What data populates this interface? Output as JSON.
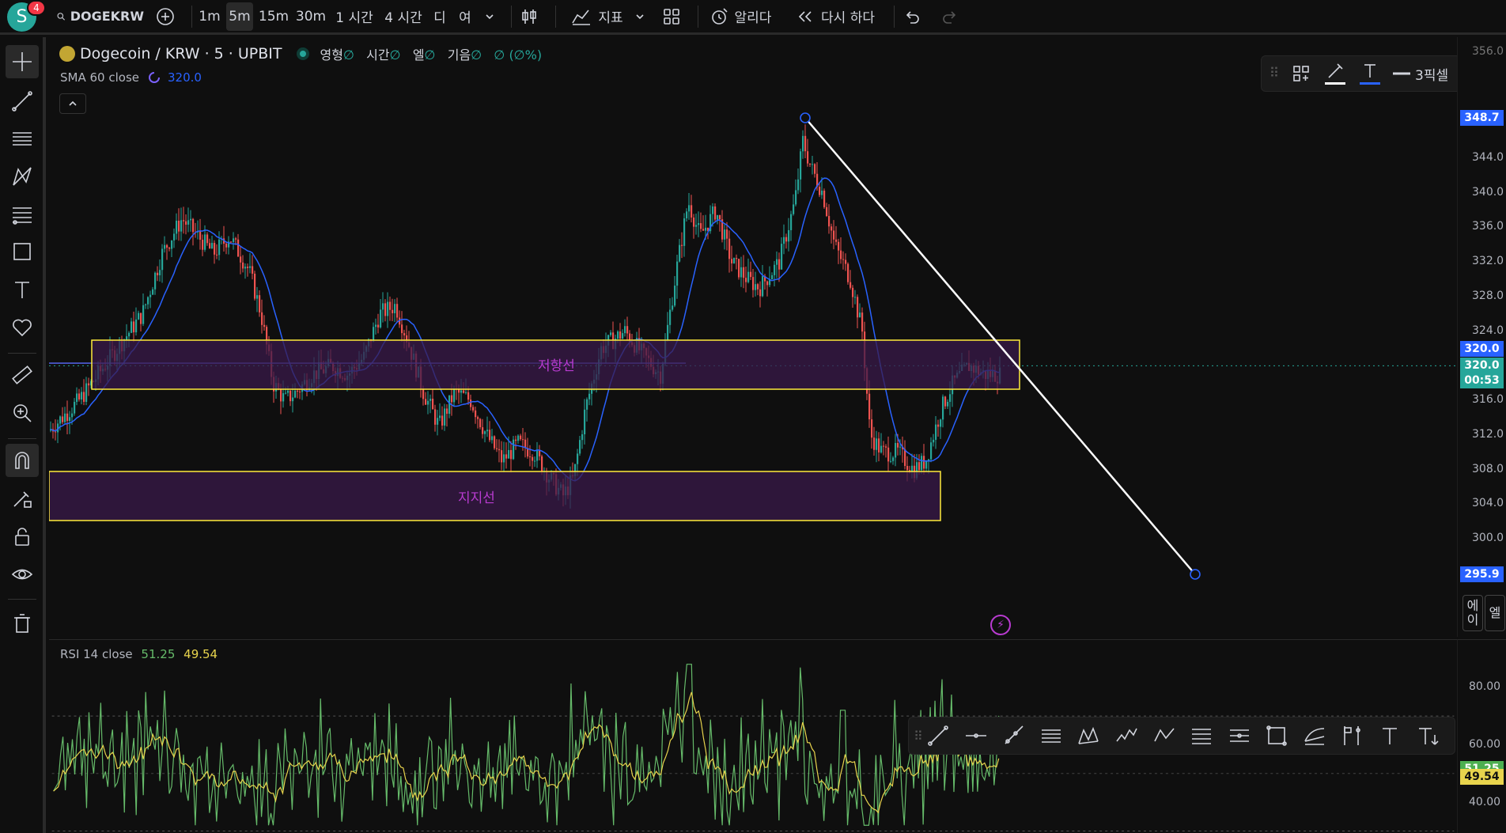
{
  "topbar": {
    "user_initial": "S",
    "notifications": "4",
    "symbol": "DOGEKRW",
    "intervals": [
      "1m",
      "5m",
      "15m",
      "30m",
      "1 시간",
      "4 시간",
      "디",
      "여"
    ],
    "active_interval": "5m",
    "indicators_label": "지표",
    "alert_label": "알리다",
    "replay_label": "다시 하다"
  },
  "legend": {
    "title": "Dogecoin / KRW · 5 · UPBIT",
    "ohlc_open": "영형",
    "ohlc_high": "시간",
    "ohlc_low": "엘",
    "ohlc_close": "기음",
    "ohlc_change": "(∅%)",
    "empty_val": "∅"
  },
  "sma": {
    "label": "SMA 60 close",
    "value": "320.0"
  },
  "draw_toolbar": {
    "thickness_label": "3픽셀"
  },
  "zones": {
    "resistance_label": "저항선",
    "support_label": "지지선"
  },
  "price_axis": {
    "ticks": [
      "344.0",
      "340.0",
      "336.0",
      "332.0",
      "328.0",
      "324.0",
      "316.0",
      "312.0",
      "308.0",
      "304.0",
      "300.0"
    ],
    "partial_top": "356.0",
    "tag_high": "348.7",
    "tag_sma": "320.0",
    "tag_last": "320.0",
    "tag_countdown": "00:53",
    "tag_low": "295.9"
  },
  "side_buttons": [
    "에이",
    "엘"
  ],
  "rsi": {
    "label": "RSI 14 close",
    "value": "51.25",
    "ma_value": "49.54",
    "ticks": [
      "80.00",
      "60.00",
      "40.00"
    ]
  },
  "colors": {
    "bg": "#0f0f0f",
    "up": "#26a69a",
    "down": "#ef5350",
    "sma": "#2962ff",
    "zone_border": "#ffeb3b",
    "zone_fill": "#3a1a4a",
    "rsi": "#66bb6a",
    "rsi_ma": "#e8d44d"
  }
}
